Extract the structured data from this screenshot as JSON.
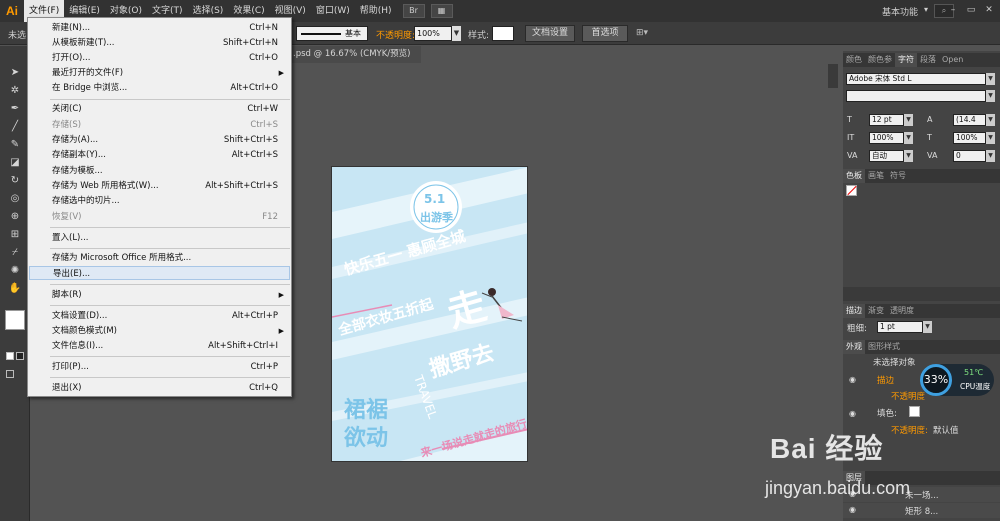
{
  "app": {
    "logo": "Ai"
  },
  "menubar": {
    "items": [
      "文件(F)",
      "编辑(E)",
      "对象(O)",
      "文字(T)",
      "选择(S)",
      "效果(C)",
      "视图(V)",
      "窗口(W)",
      "帮助(H)"
    ],
    "workspace": "基本功能",
    "workspace_arrow": "▾",
    "search_icon": "⌕",
    "window_controls": [
      "–",
      "▭",
      "✕"
    ]
  },
  "controlbar": {
    "selection_label": "未选",
    "stroke_label": "基本",
    "opacity_label": "不透明度:",
    "opacity_value": "100%",
    "style_label": "样式:",
    "doc_setup": "文档设置",
    "preferences": "首选项",
    "arrange_icon": "⊞▾"
  },
  "document": {
    "tab_title": ".psd @ 16.67% (CMYK/预览)"
  },
  "file_menu": {
    "items": [
      {
        "label": "新建(N)...",
        "shortcut": "Ctrl+N"
      },
      {
        "label": "从模板新建(T)...",
        "shortcut": "Shift+Ctrl+N"
      },
      {
        "label": "打开(O)...",
        "shortcut": "Ctrl+O"
      },
      {
        "label": "最近打开的文件(F)",
        "shortcut": ""
      },
      {
        "label": "在 Bridge 中浏览...",
        "shortcut": "Alt+Ctrl+O"
      },
      {
        "label": "关闭(C)",
        "shortcut": "Ctrl+W"
      },
      {
        "label": "存储(S)",
        "shortcut": "Ctrl+S"
      },
      {
        "label": "存储为(A)...",
        "shortcut": "Shift+Ctrl+S"
      },
      {
        "label": "存储副本(Y)...",
        "shortcut": "Alt+Ctrl+S"
      },
      {
        "label": "存储为模板...",
        "shortcut": ""
      },
      {
        "label": "存储为 Web 所用格式(W)...",
        "shortcut": "Alt+Shift+Ctrl+S"
      },
      {
        "label": "存储选中的切片...",
        "shortcut": ""
      },
      {
        "label": "恢复(V)",
        "shortcut": "F12"
      },
      {
        "label": "置入(L)...",
        "shortcut": ""
      },
      {
        "label": "存储为 Microsoft Office 所用格式...",
        "shortcut": ""
      },
      {
        "label": "导出(E)...",
        "shortcut": ""
      },
      {
        "label": "脚本(R)",
        "shortcut": ""
      },
      {
        "label": "文档设置(D)...",
        "shortcut": "Alt+Ctrl+P"
      },
      {
        "label": "文档颜色模式(M)",
        "shortcut": ""
      },
      {
        "label": "文件信息(I)...",
        "shortcut": "Alt+Shift+Ctrl+I"
      },
      {
        "label": "打印(P)...",
        "shortcut": "Ctrl+P"
      },
      {
        "label": "退出(X)",
        "shortcut": "Ctrl+Q"
      }
    ],
    "submenu_arrow": "▶"
  },
  "poster": {
    "badge_top": "5.1",
    "badge_bottom": "出游季",
    "headline1": "快乐五一 惠顾全城",
    "headline2": "全部衣妆五折起",
    "big_char1": "走",
    "big_char2": "撒野去",
    "left_title1": "裙裾",
    "left_title2": "欲动",
    "travel": "TRAVEL",
    "tagline": "来一场说走就走的旅行"
  },
  "character_panel": {
    "tabs": [
      "颜色",
      "颜色参",
      "字符",
      "段落",
      "Open"
    ],
    "font_family": "Adobe 宋体 Std L",
    "font_size": "12 pt",
    "leading": "(14.4",
    "h_scale": "100%",
    "v_scale": "100%",
    "tracking_mode": "自动",
    "tracking": "0"
  },
  "swatches_panel": {
    "tabs": [
      "色板",
      "画笔",
      "符号"
    ]
  },
  "stroke_panel": {
    "tabs": [
      "描边",
      "渐变",
      "透明度"
    ],
    "weight_label": "粗细:",
    "weight_value": "1 pt"
  },
  "appearance_panel": {
    "tabs": [
      "外观",
      "图形样式"
    ],
    "header": "未选择对象",
    "stroke_label": "描边",
    "opacity1": "不透明度",
    "fill_label": "填色:",
    "opacity2": "不透明度:",
    "opacity2_value": "默认值"
  },
  "layers_panel": {
    "tabs": [
      "图层"
    ],
    "rows": [
      "未一场...",
      "矩形 8..."
    ]
  },
  "cpu_widget": {
    "percent": "33%",
    "temp": "51℃",
    "label": "CPU温度"
  },
  "watermark": {
    "brand": "Bai 经验",
    "url": "jingyan.baidu.com"
  },
  "colors": {
    "accent_orange": "#ff9a00",
    "ui_dark": "#323232",
    "panel": "#444444",
    "poster_blue": "#c8e6f4"
  }
}
